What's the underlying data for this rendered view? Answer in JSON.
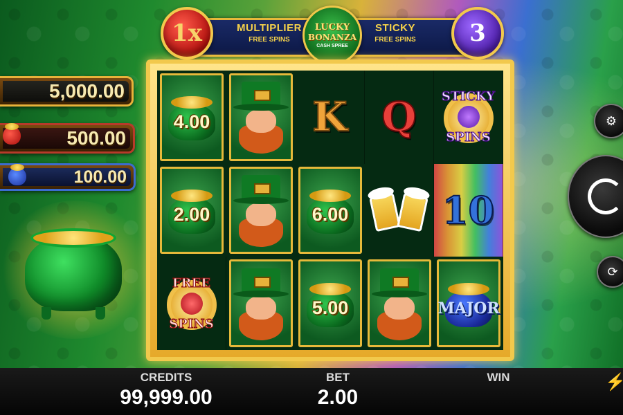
{
  "header": {
    "multiplier_value": "1x",
    "multiplier_label": "MULTIPLIER",
    "multiplier_sub": "FREE SPINS",
    "sticky_value": "3",
    "sticky_label": "STICKY",
    "sticky_sub": "FREE SPINS",
    "logo": {
      "line1": "LUCKY",
      "line2": "BONANZA",
      "line3": "CASH SPREE"
    }
  },
  "jackpots": {
    "grand": "5,000.00",
    "major": "500.00",
    "minor": "100.00"
  },
  "reels": [
    [
      {
        "type": "pot",
        "value": "4.00"
      },
      {
        "type": "leprechaun"
      },
      {
        "type": "letter",
        "value": "K"
      },
      {
        "type": "letter",
        "value": "Q"
      },
      {
        "type": "sticky",
        "line1": "STICKY",
        "line2": "SPINS"
      }
    ],
    [
      {
        "type": "pot",
        "value": "2.00"
      },
      {
        "type": "leprechaun"
      },
      {
        "type": "pot",
        "value": "6.00"
      },
      {
        "type": "beer"
      },
      {
        "type": "letter",
        "value": "10"
      }
    ],
    [
      {
        "type": "free",
        "line1": "FREE",
        "line2": "SPINS"
      },
      {
        "type": "leprechaun"
      },
      {
        "type": "pot",
        "value": "5.00"
      },
      {
        "type": "leprechaun"
      },
      {
        "type": "pot-blue",
        "value": "MAJOR"
      }
    ]
  ],
  "bottom": {
    "credits_label": "CREDITS",
    "credits_value": "99,999.00",
    "bet_label": "BET",
    "bet_value": "2.00",
    "win_label": "WIN",
    "win_value": ""
  },
  "icons": {
    "bet": "coins-stack-icon",
    "spin": "spin-icon",
    "autoplay": "autoplay-icon",
    "turbo": "lightning-bolt-icon"
  },
  "colors": {
    "gold": "#f2c94c",
    "multiplier_red": "#b5120f",
    "sticky_purple": "#4d1ea8",
    "reel_bg": "#052a12"
  }
}
